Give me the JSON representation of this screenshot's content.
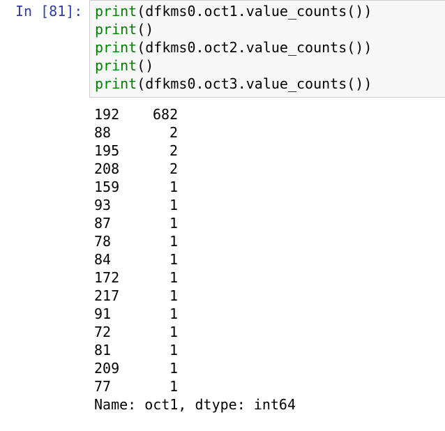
{
  "cell": {
    "prompt": "In [81]:",
    "code_lines": [
      {
        "fn": "print",
        "args": "(dfkms0.oct1.value_counts())"
      },
      {
        "fn": "print",
        "args": "()"
      },
      {
        "fn": "print",
        "args": "(dfkms0.oct2.value_counts())"
      },
      {
        "fn": "print",
        "args": "()"
      },
      {
        "fn": "print",
        "args": "(dfkms0.oct3.value_counts())"
      }
    ]
  },
  "output": {
    "rows": [
      {
        "index": "192",
        "count": "682"
      },
      {
        "index": "88",
        "count": "2"
      },
      {
        "index": "195",
        "count": "2"
      },
      {
        "index": "208",
        "count": "2"
      },
      {
        "index": "159",
        "count": "1"
      },
      {
        "index": "93",
        "count": "1"
      },
      {
        "index": "87",
        "count": "1"
      },
      {
        "index": "78",
        "count": "1"
      },
      {
        "index": "84",
        "count": "1"
      },
      {
        "index": "172",
        "count": "1"
      },
      {
        "index": "217",
        "count": "1"
      },
      {
        "index": "91",
        "count": "1"
      },
      {
        "index": "72",
        "count": "1"
      },
      {
        "index": "81",
        "count": "1"
      },
      {
        "index": "209",
        "count": "1"
      },
      {
        "index": "77",
        "count": "1"
      }
    ],
    "footer": "Name: oct1, dtype: int64"
  },
  "colors": {
    "prompt": "#303f9f",
    "keyword": "#008000",
    "input_bg": "#f7f7f7",
    "input_border": "#cfcfcf"
  }
}
